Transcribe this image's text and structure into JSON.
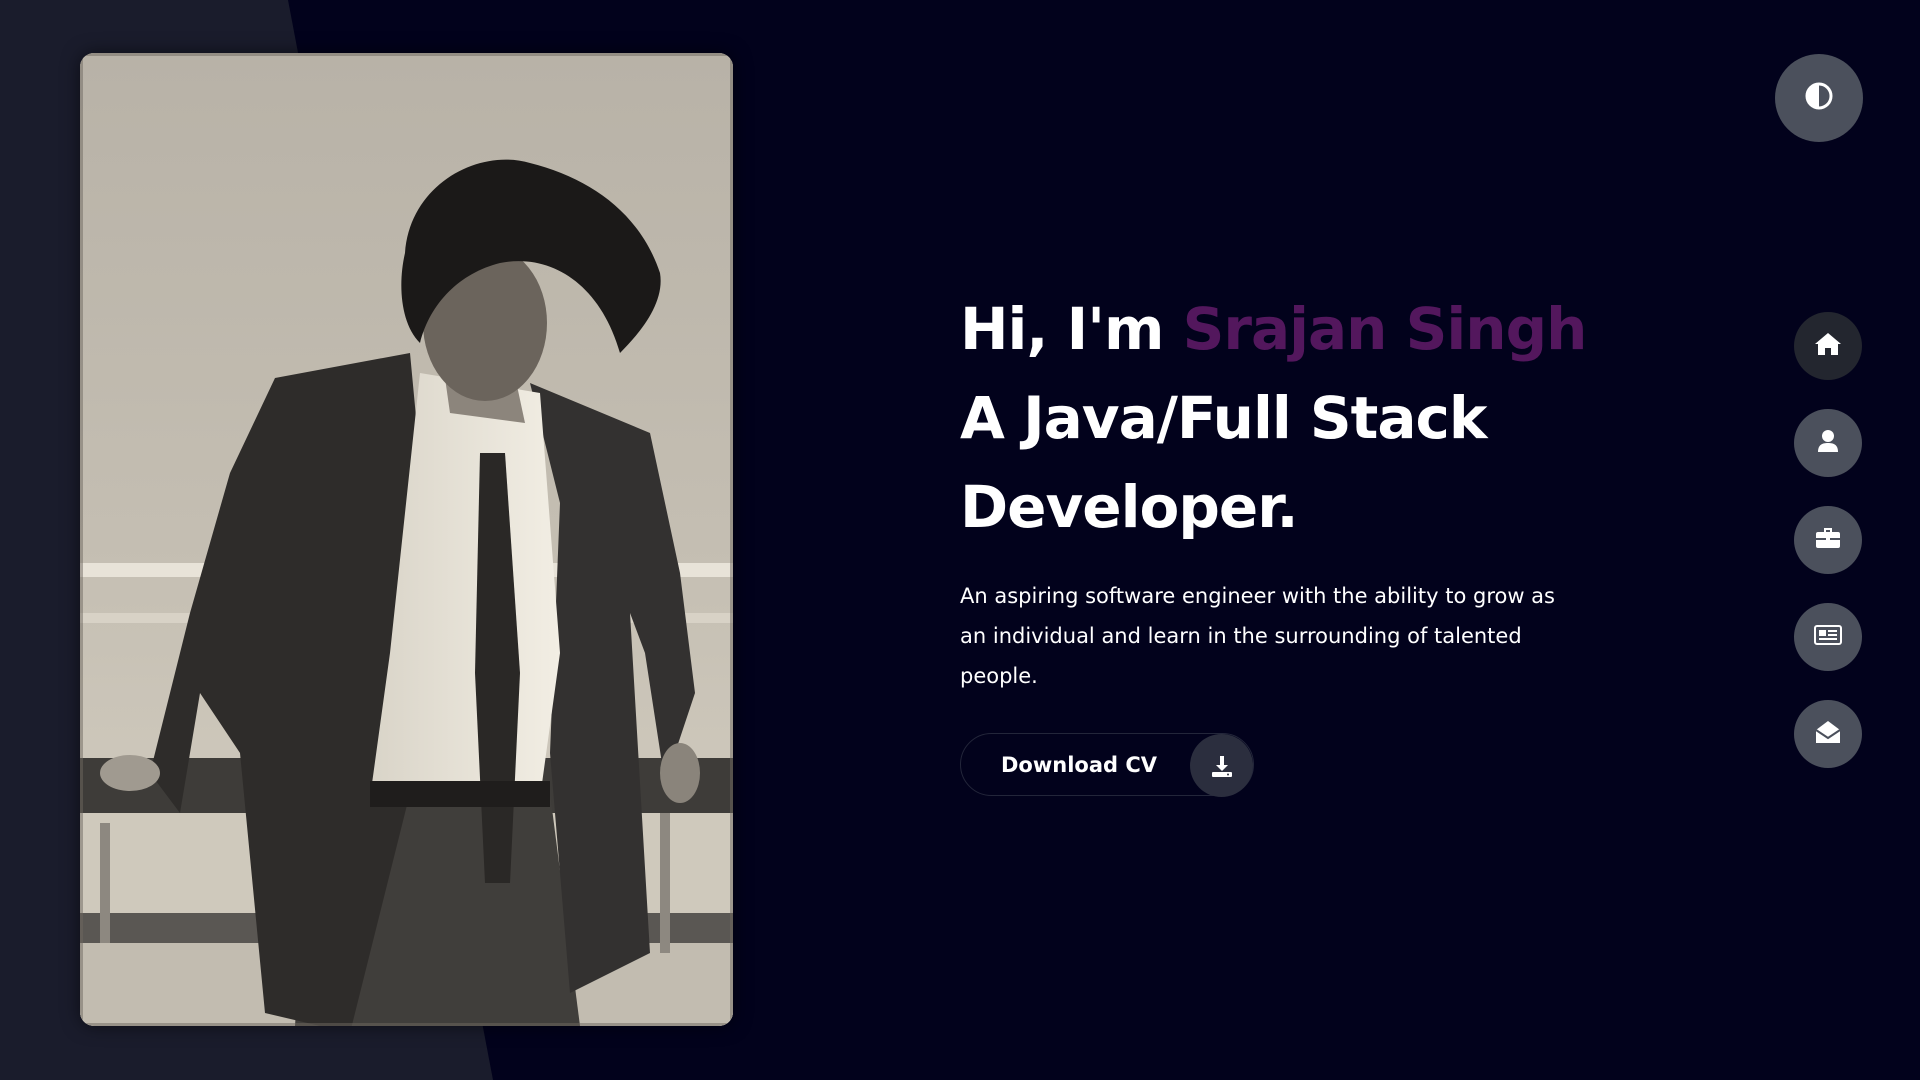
{
  "hero": {
    "greeting": "Hi, I'm ",
    "name": "Srajan Singh",
    "role_line1": "A Java/Full Stack",
    "role_line2": "Developer.",
    "description": "An aspiring software engineer with the ability to grow as an individual and learn in the surrounding of talented people.",
    "download_label": "Download CV"
  },
  "colors": {
    "background": "#02021c",
    "left_panel": "#1a1c2c",
    "accent": "#53175d",
    "nav_button": "#4b505c",
    "nav_button_active": "#23262f"
  },
  "icons": {
    "theme_toggle": "contrast-icon",
    "download": "download-icon",
    "nav": [
      "home-icon",
      "user-icon",
      "briefcase-icon",
      "newspaper-icon",
      "envelope-open-icon"
    ]
  }
}
